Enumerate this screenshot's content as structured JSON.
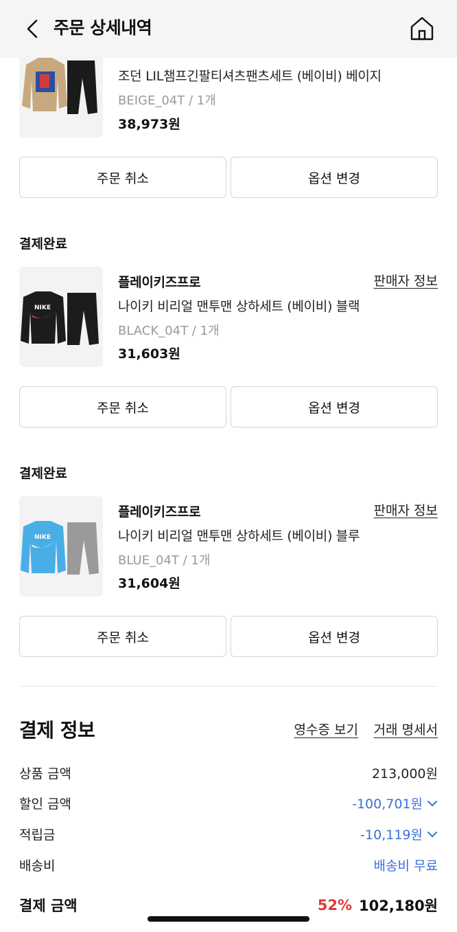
{
  "header": {
    "title": "주문 상세내역"
  },
  "items": [
    {
      "status": "",
      "seller": "",
      "seller_link": "",
      "name": "조던 LIL챔프긴팔티셔츠팬츠세트 (베이비) 베이지",
      "option": "BEIGE_04T / 1개",
      "price": "38,973원",
      "cancel_label": "주문 취소",
      "change_label": "옵션 변경",
      "top_color": "#c8a87e",
      "bottom_color": "#1b1b1b"
    },
    {
      "status": "결제완료",
      "seller": "플레이키즈프로",
      "seller_link": "판매자 정보",
      "name": "나이키 비리얼 맨투맨 상하세트 (베이비) 블랙",
      "option": "BLACK_04T / 1개",
      "price": "31,603원",
      "cancel_label": "주문 취소",
      "change_label": "옵션 변경",
      "top_color": "#1c1c1c",
      "bottom_color": "#1c1c1c"
    },
    {
      "status": "결제완료",
      "seller": "플레이키즈프로",
      "seller_link": "판매자 정보",
      "name": "나이키 비리얼 맨투맨 상하세트 (베이비) 블루",
      "option": "BLUE_04T / 1개",
      "price": "31,604원",
      "cancel_label": "주문 취소",
      "change_label": "옵션 변경",
      "top_color": "#4aaee6",
      "bottom_color": "#9a9a9a"
    }
  ],
  "payment": {
    "title": "결제 정보",
    "receipt_link": "영수증 보기",
    "statement_link": "거래 명세서",
    "rows": [
      {
        "label": "상품 금액",
        "value": "213,000원"
      },
      {
        "label": "할인 금액",
        "value": "-100,701원"
      },
      {
        "label": "적립금",
        "value": "-10,119원"
      },
      {
        "label": "배송비",
        "value": "배송비 무료"
      }
    ],
    "total_label": "결제 금액",
    "total_percent": "52%",
    "total_value": "102,180원",
    "accent_blue": "#3a6fd8",
    "accent_red": "#e53935"
  }
}
